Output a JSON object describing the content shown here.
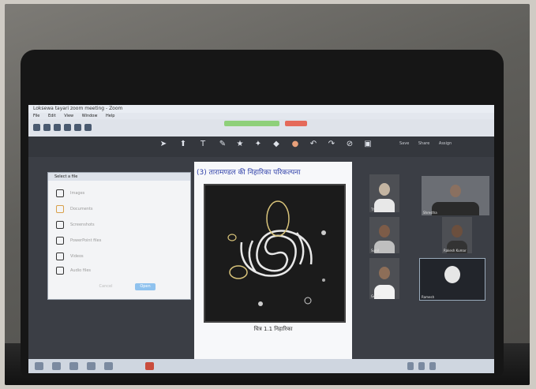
{
  "window": {
    "title": "Loksewa tayari zoom meeting - Zoom",
    "menu": [
      "File",
      "Edit",
      "View",
      "Window",
      "Help"
    ]
  },
  "toolbar_right": [
    "Save",
    "Share",
    "Assign"
  ],
  "dialog": {
    "title": "Select a file",
    "items": [
      "Images",
      "Documents",
      "Screenshots",
      "PowerPoint files",
      "Videos",
      "Audio files"
    ],
    "ok_label": "Open",
    "cancel_label": "Cancel"
  },
  "slide": {
    "heading": "(3) तारामण्डल की निहारिका परिकल्पना",
    "caption": "चित्र 1.1   निहारिका"
  },
  "participants": [
    {
      "name": "Thapa"
    },
    {
      "name": "Shrestha"
    },
    {
      "name": "Sunil"
    },
    {
      "name": "Rakesh Kumar"
    },
    {
      "name": "Gopal"
    },
    {
      "name": "Ramesh"
    }
  ],
  "colors": {
    "heading": "#2d3ea8",
    "dialog_ok": "#8fc2ee",
    "tab_green": "#8fd07a",
    "tab_red": "#e56a5a"
  }
}
